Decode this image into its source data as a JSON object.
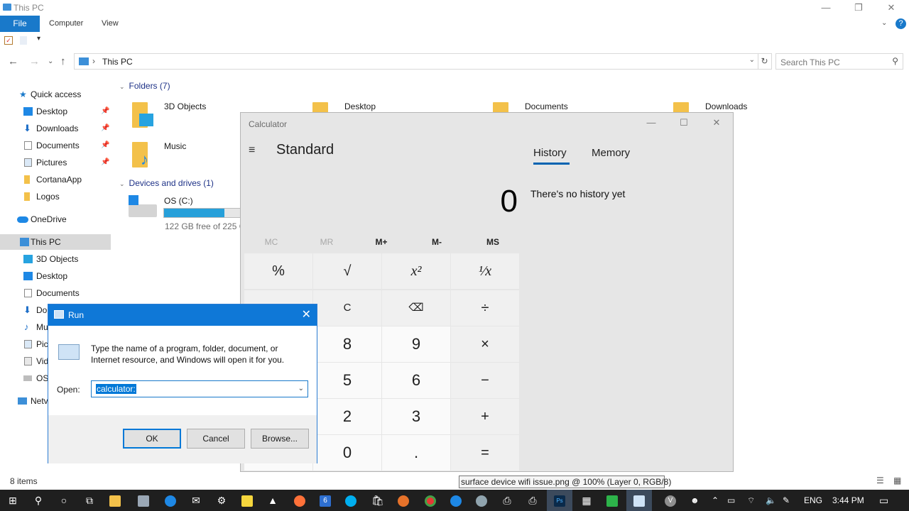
{
  "explorer": {
    "title": "This PC",
    "tabs": [
      "File",
      "Computer",
      "View"
    ],
    "address": "This PC",
    "search_placeholder": "Search This PC",
    "nav": [
      {
        "label": "Quick access",
        "pin": false
      },
      {
        "label": "Desktop",
        "pin": true
      },
      {
        "label": "Downloads",
        "pin": true
      },
      {
        "label": "Documents",
        "pin": true
      },
      {
        "label": "Pictures",
        "pin": true
      },
      {
        "label": "CortanaApp",
        "pin": false
      },
      {
        "label": "Logos",
        "pin": false
      },
      {
        "label": "OneDrive",
        "pin": false
      },
      {
        "label": "This PC",
        "pin": false
      },
      {
        "label": "3D Objects",
        "pin": false
      },
      {
        "label": "Desktop",
        "pin": false
      },
      {
        "label": "Documents",
        "pin": false
      },
      {
        "label": "Do",
        "pin": false
      },
      {
        "label": "Mu",
        "pin": false
      },
      {
        "label": "Pic",
        "pin": false
      },
      {
        "label": "Vid",
        "pin": false
      },
      {
        "label": "OS",
        "pin": false
      },
      {
        "label": "Netv",
        "pin": false
      }
    ],
    "folders_header": "Folders (7)",
    "folders": [
      "3D Objects",
      "Desktop",
      "Documents",
      "Downloads",
      "Music"
    ],
    "devices_header": "Devices and drives (1)",
    "drive": {
      "label": "OS (C:)",
      "free_text": "122 GB free of 225 G",
      "used_fraction": 0.54
    },
    "status": "8 items"
  },
  "calculator": {
    "title": "Calculator",
    "mode": "Standard",
    "display": "0",
    "history_tab": "History",
    "memory_tab": "Memory",
    "no_history": "There's no history yet",
    "memory_keys": [
      "MC",
      "MR",
      "M+",
      "M-",
      "MS"
    ],
    "keys_row1": [
      "%",
      "√",
      "x²",
      "¹⁄x"
    ],
    "keys_row2": [
      "C",
      "⌫",
      "÷"
    ],
    "keys_row3": [
      "8",
      "9",
      "×"
    ],
    "keys_row4": [
      "5",
      "6",
      "−"
    ],
    "keys_row5": [
      "2",
      "3",
      "+"
    ],
    "keys_row6": [
      "0",
      ".",
      "="
    ]
  },
  "run": {
    "title": "Run",
    "description": "Type the name of a program, folder, document, or Internet resource, and Windows will open it for you.",
    "open_label": "Open:",
    "value": "calculator:",
    "ok": "OK",
    "cancel": "Cancel",
    "browse": "Browse..."
  },
  "tooltip": "surface device wifi issue.png @ 100% (Layer 0, RGB/8)",
  "taskbar": {
    "language": "ENG",
    "time": "3:44 PM",
    "avatar_letter": "V",
    "calendar_badge": "6"
  }
}
